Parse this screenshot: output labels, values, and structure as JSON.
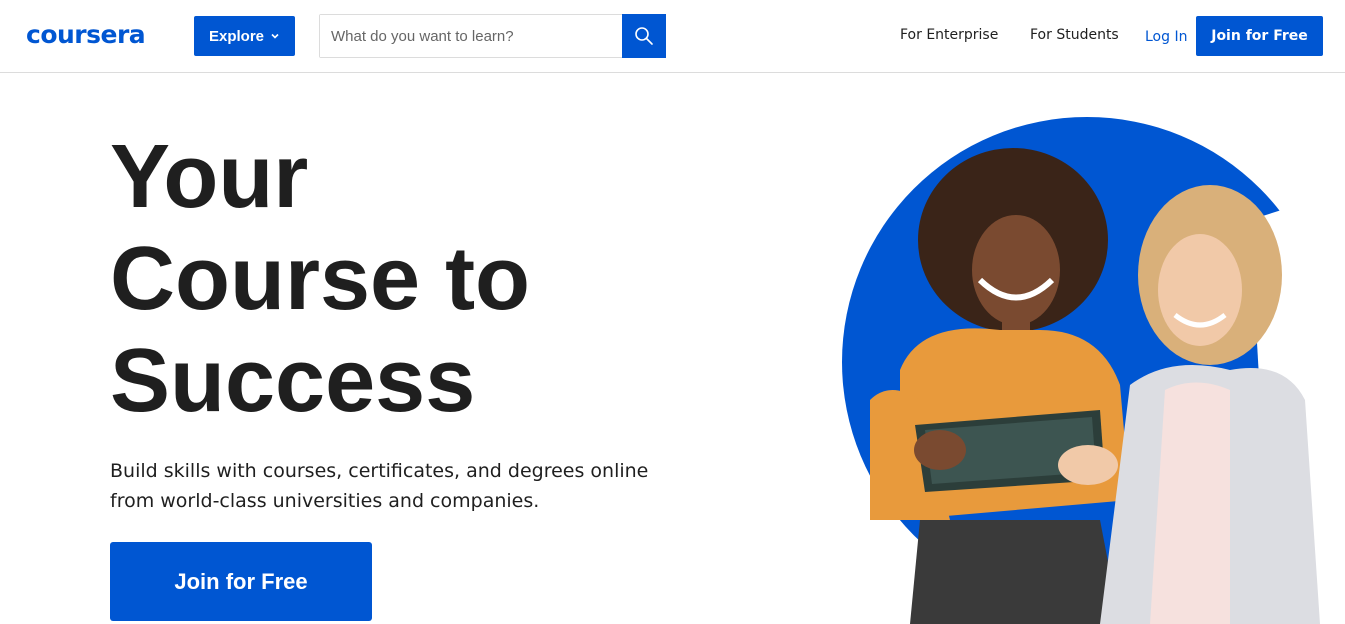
{
  "header": {
    "logo_text": "coursera",
    "explore_label": "Explore",
    "search": {
      "placeholder": "What do you want to learn?",
      "value": ""
    },
    "nav": {
      "enterprise": "For Enterprise",
      "students": "For Students",
      "login": "Log In"
    },
    "join_label": "Join for Free"
  },
  "hero": {
    "title_lines": [
      "Your",
      "Course to",
      "Success"
    ],
    "subtitle_lines": [
      "Build skills with courses, certificates, and degrees online",
      "from world-class universities and companies."
    ],
    "cta_label": "Join for Free"
  },
  "colors": {
    "brand_blue": "#0056d2",
    "text_dark": "#1f1f1f",
    "border": "#dcdcdc"
  },
  "icons": {
    "explore_chevron": "chevron-down-icon",
    "search": "search-icon"
  }
}
